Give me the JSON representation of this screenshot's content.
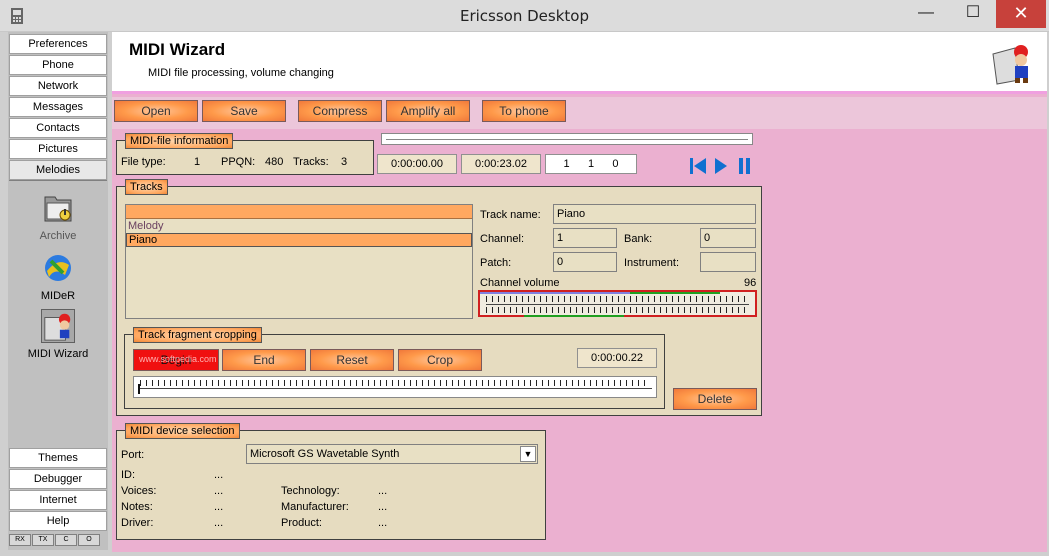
{
  "window": {
    "title": "Ericsson Desktop",
    "min": "—",
    "max": "☐",
    "close": "✕"
  },
  "nav": {
    "top": [
      "Preferences",
      "Phone",
      "Network",
      "Messages",
      "Contacts",
      "Pictures",
      "Melodies"
    ],
    "tools": [
      "Archive",
      "MIDeR",
      "MIDI Wizard"
    ],
    "bottom": [
      "Themes",
      "Debugger",
      "Internet",
      "Help"
    ],
    "status": [
      "RX",
      "TX",
      "C",
      "O"
    ]
  },
  "header": {
    "title": "MIDI Wizard",
    "subtitle": "MIDI file processing, volume changing"
  },
  "toolbar": {
    "open": "Open",
    "save": "Save",
    "compress": "Compress",
    "amplify": "Amplify all",
    "to_phone": "To phone"
  },
  "file_info": {
    "title": "MIDI-file information",
    "file_type_label": "File type:",
    "file_type": "1",
    "ppqn_label": "PPQN:",
    "ppqn": "480",
    "tracks_label": "Tracks:",
    "tracks": "3"
  },
  "player": {
    "position": "0:00:00.00",
    "duration": "0:00:23.02",
    "bar": "1",
    "beat": "1",
    "tick": "0"
  },
  "tracks": {
    "title": "Tracks",
    "items": [
      "",
      "Melody",
      "Piano"
    ],
    "name_label": "Track name:",
    "name": "Piano",
    "channel_label": "Channel:",
    "channel": "1",
    "bank_label": "Bank:",
    "bank": "0",
    "patch_label": "Patch:",
    "patch": "0",
    "instrument_label": "Instrument:",
    "instrument": "",
    "volume_label": "Channel volume",
    "volume": "96"
  },
  "cropping": {
    "title": "Track fragment cropping",
    "begin": "Begin",
    "end": "End",
    "reset": "Reset",
    "crop": "Crop",
    "time": "0:00:00.22",
    "watermark": "www.softpedia.com"
  },
  "delete_label": "Delete",
  "device": {
    "title": "MIDI device selection",
    "port_label": "Port:",
    "port": "Microsoft GS Wavetable Synth",
    "id_label": "ID:",
    "id": "...",
    "voices_label": "Voices:",
    "voices": "...",
    "notes_label": "Notes:",
    "notes": "...",
    "driver_label": "Driver:",
    "driver": "...",
    "technology_label": "Technology:",
    "technology": "...",
    "manufacturer_label": "Manufacturer:",
    "manufacturer": "...",
    "product_label": "Product:",
    "product": "..."
  }
}
